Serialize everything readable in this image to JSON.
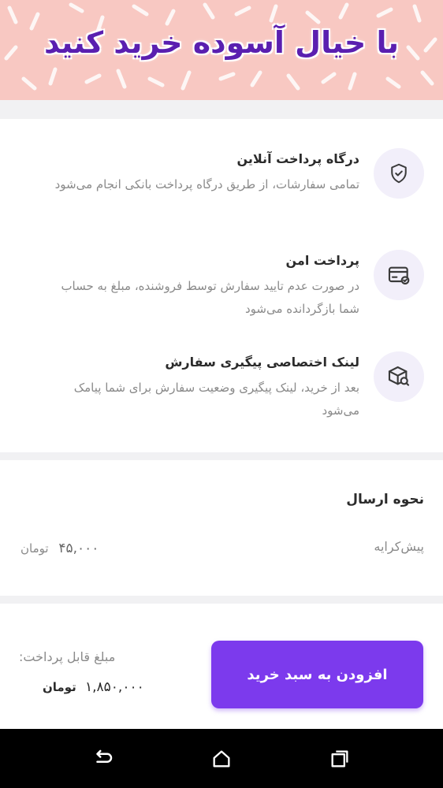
{
  "banner": {
    "title": "با خیال آسوده خرید کنید"
  },
  "features": [
    {
      "title": "درگاه پرداخت آنلاین",
      "description": "تمامی سفارشات، از طریق درگاه پرداخت بانکی انجام می‌شود",
      "icon": "shield-check-icon"
    },
    {
      "title": "پرداخت امن",
      "description": "در صورت عدم تایید سفارش توسط فروشنده، مبلغ به حساب شما بازگردانده می‌شود",
      "icon": "card-check-icon"
    },
    {
      "title": "لینک اختصاصی پیگیری سفارش",
      "description": "بعد از خرید، لینک پیگیری وضعیت سفارش برای شما پیامک می‌شود",
      "icon": "box-search-icon"
    }
  ],
  "shipping": {
    "title": "نحوه ارسال",
    "method": "پیش‌کرایه",
    "price": "۴۵,۰۰۰",
    "currency": "تومان"
  },
  "payment": {
    "label": "مبلغ قابل پرداخت:",
    "amount": "۱,۸۵۰,۰۰۰",
    "currency": "تومان"
  },
  "cart_button": {
    "label": "افزودن به سبد خرید"
  },
  "colors": {
    "accent": "#7c3aed",
    "banner_bg": "#f8c8c2",
    "banner_text": "#5a1fb0"
  },
  "navbar": {
    "icons": [
      "back-icon",
      "home-icon",
      "recents-icon"
    ]
  }
}
